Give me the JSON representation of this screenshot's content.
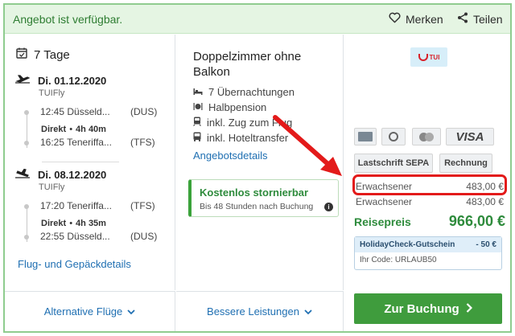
{
  "header": {
    "availability": "Angebot ist verfügbar.",
    "merken_label": "Merken",
    "teilen_label": "Teilen"
  },
  "flights": {
    "duration": "7 Tage",
    "outbound": {
      "date": "Di. 01.12.2020",
      "airline": "TUIFly",
      "dep_time_city": "12:45 Düsseld...",
      "dep_code": "(DUS)",
      "direct": "Direkt",
      "duration": "4h 40m",
      "arr_time_city": "16:25 Teneriffa...",
      "arr_code": "(TFS)"
    },
    "return": {
      "date": "Di. 08.12.2020",
      "airline": "TUIFly",
      "dep_time_city": "17:20 Teneriffa...",
      "dep_code": "(TFS)",
      "direct": "Direkt",
      "duration": "4h 35m",
      "arr_time_city": "22:55 Düsseld...",
      "arr_code": "(DUS)"
    },
    "details_link": "Flug- und Gepäckdetails"
  },
  "hotel": {
    "room": "Doppelzimmer ohne Balkon",
    "features": [
      "7 Übernachtungen",
      "Halbpension",
      "inkl. Zug zum Flug",
      "inkl. Hoteltransfer"
    ],
    "details_link": "Angebotsdetails",
    "cancel_title": "Kostenlos stornierbar",
    "cancel_sub": "Bis 48 Stunden nach Buchung"
  },
  "pricing": {
    "operator": "TUI",
    "payment": {
      "amex": "",
      "diners": "",
      "mastercard": "",
      "visa": "VISA",
      "sepa": "Lastschrift SEPA",
      "invoice": "Rechnung"
    },
    "rows": [
      {
        "label": "Erwachsener",
        "price": "483,00 €"
      },
      {
        "label": "Erwachsener",
        "price": "483,00 €"
      }
    ],
    "total_label": "Reisepreis",
    "total_value": "966,00 €",
    "voucher_title": "HolidayCheck-Gutschein",
    "voucher_amount": "- 50 €",
    "voucher_code": "Ihr Code: URLAUB50",
    "book_label": "Zur Buchung"
  },
  "footer": {
    "alt_flights": "Alternative Flüge",
    "better_services": "Bessere Leistungen"
  },
  "colors": {
    "accent_green": "#3f9c3d",
    "link_blue": "#1f6fb2",
    "highlight_red": "#e31a1a"
  }
}
